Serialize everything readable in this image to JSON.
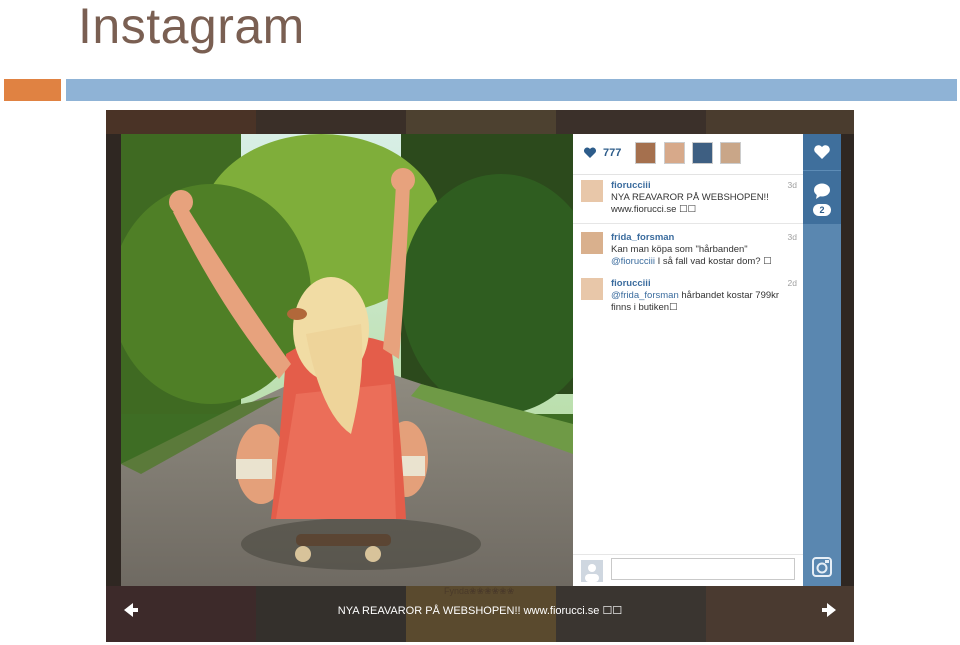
{
  "slide": {
    "title": "Instagram"
  },
  "panel": {
    "likes_count": "777",
    "comments": [
      {
        "user": "fiorucciii",
        "time": "3d",
        "text": "NYA REAVAROR PÅ WEBSHOPEN!! www.fiorucci.se ☐☐",
        "mention": ""
      },
      {
        "user": "frida_forsman",
        "time": "3d",
        "text_a": "Kan man köpa som \"hårbanden\"",
        "mention": "@fiorucciii",
        "text_b": " I så fall vad kostar dom? ☐"
      },
      {
        "user": "fiorucciii",
        "time": "2d",
        "mention": "@frida_forsman",
        "text_b": " hårbandet kostar 799kr finns i butiken☐"
      }
    ],
    "comment_placeholder": "",
    "comment_count_badge": "2"
  },
  "viewer": {
    "caption": "NYA REAVAROR PÅ WEBSHOPEN!! www.fiorucci.se ☐☐",
    "background_snippet": "Fynda❀❀❀❀❀❀"
  },
  "colors": {
    "title": "#7a5f52",
    "accent_orange": "#e08242",
    "accent_blue": "#8fb3d6",
    "sidebar_blue": "#5a87b0",
    "link_blue": "#3b6c9e"
  },
  "icons": {
    "like": "heart-icon",
    "comment": "speech-bubble-icon",
    "instagram": "instagram-camera-icon",
    "prev": "arrow-left-icon",
    "next": "arrow-right-icon"
  }
}
